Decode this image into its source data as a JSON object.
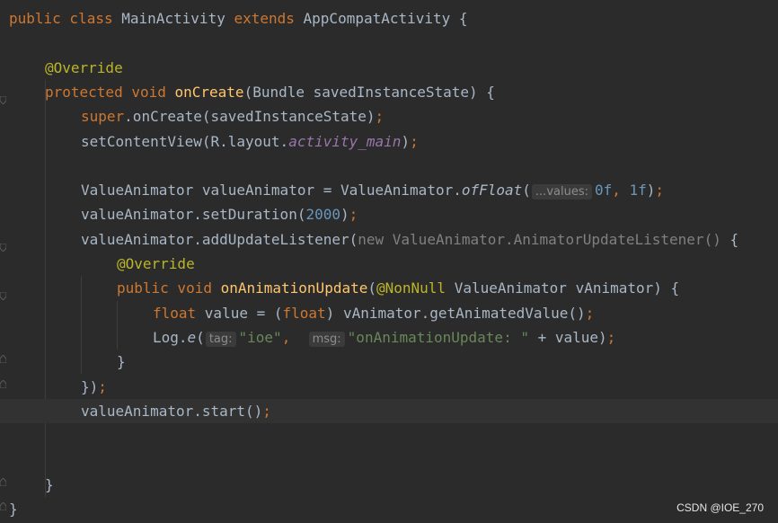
{
  "colors": {
    "keyword": "#cc7832",
    "default": "#a9b7c6",
    "annotation": "#bbb529",
    "method_decl": "#ffc66d",
    "number": "#6897bb",
    "string": "#6a8759",
    "field": "#9876aa",
    "dim": "#808080",
    "background": "#2b2b2b",
    "current_line": "#323232"
  },
  "code_lines": [
    {
      "id": "l1",
      "indent": 0,
      "tokens": [
        {
          "t": "public class ",
          "c": "keyword"
        },
        {
          "t": "MainActivity ",
          "c": "default"
        },
        {
          "t": "extends ",
          "c": "keyword"
        },
        {
          "t": "AppCompatActivity {",
          "c": "default"
        }
      ]
    },
    {
      "id": "l2",
      "indent": 0,
      "tokens": []
    },
    {
      "id": "l3",
      "indent": 1,
      "tokens": [
        {
          "t": "@Override",
          "c": "annotation"
        }
      ]
    },
    {
      "id": "l4",
      "indent": 1,
      "tokens": [
        {
          "t": "protected void ",
          "c": "keyword"
        },
        {
          "t": "onCreate",
          "c": "method_decl"
        },
        {
          "t": "(Bundle savedInstanceState) {",
          "c": "default"
        }
      ]
    },
    {
      "id": "l5",
      "indent": 2,
      "tokens": [
        {
          "t": "super",
          "c": "keyword"
        },
        {
          "t": ".onCreate(savedInstanceState)",
          "c": "default"
        },
        {
          "t": ";",
          "c": "keyword"
        }
      ]
    },
    {
      "id": "l6",
      "indent": 2,
      "tokens": [
        {
          "t": "setContentView(R.layout.",
          "c": "default"
        },
        {
          "t": "activity_main",
          "c": "field",
          "italic": true
        },
        {
          "t": ")",
          "c": "default"
        },
        {
          "t": ";",
          "c": "keyword"
        }
      ]
    },
    {
      "id": "l7",
      "indent": 0,
      "tokens": []
    },
    {
      "id": "l8",
      "indent": 2,
      "tokens": [
        {
          "t": "ValueAnimator valueAnimator = ValueAnimator.",
          "c": "default"
        },
        {
          "t": "ofFloat",
          "c": "default",
          "italic": true
        },
        {
          "t": "(",
          "c": "default"
        },
        {
          "t": "...values:",
          "hint": true
        },
        {
          "t": "0f",
          "c": "number"
        },
        {
          "t": ", ",
          "c": "keyword"
        },
        {
          "t": "1f",
          "c": "number"
        },
        {
          "t": ")",
          "c": "default"
        },
        {
          "t": ";",
          "c": "keyword"
        }
      ]
    },
    {
      "id": "l9",
      "indent": 2,
      "tokens": [
        {
          "t": "valueAnimator.setDuration(",
          "c": "default"
        },
        {
          "t": "2000",
          "c": "number"
        },
        {
          "t": ")",
          "c": "default"
        },
        {
          "t": ";",
          "c": "keyword"
        }
      ]
    },
    {
      "id": "l10",
      "indent": 2,
      "tokens": [
        {
          "t": "valueAnimator.addUpdateListener(",
          "c": "default"
        },
        {
          "t": "new ValueAnimator.AnimatorUpdateListener() ",
          "c": "dim"
        },
        {
          "t": "{",
          "c": "default"
        }
      ]
    },
    {
      "id": "l11",
      "indent": 3,
      "tokens": [
        {
          "t": "@Override",
          "c": "annotation"
        }
      ]
    },
    {
      "id": "l12",
      "indent": 3,
      "tokens": [
        {
          "t": "public void ",
          "c": "keyword"
        },
        {
          "t": "onAnimationUpdate",
          "c": "method_decl"
        },
        {
          "t": "(",
          "c": "default"
        },
        {
          "t": "@NonNull ",
          "c": "annotation"
        },
        {
          "t": "ValueAnimator vAnimator) {",
          "c": "default"
        }
      ]
    },
    {
      "id": "l13",
      "indent": 4,
      "tokens": [
        {
          "t": "float ",
          "c": "keyword"
        },
        {
          "t": "value = (",
          "c": "default"
        },
        {
          "t": "float",
          "c": "keyword"
        },
        {
          "t": ") vAnimator.getAnimatedValue()",
          "c": "default"
        },
        {
          "t": ";",
          "c": "keyword"
        }
      ]
    },
    {
      "id": "l14",
      "indent": 4,
      "tokens": [
        {
          "t": "Log.",
          "c": "default"
        },
        {
          "t": "e",
          "c": "default",
          "italic": true
        },
        {
          "t": "(",
          "c": "default"
        },
        {
          "t": "tag:",
          "hint": true
        },
        {
          "t": "\"ioe\"",
          "c": "string"
        },
        {
          "t": ",  ",
          "c": "keyword"
        },
        {
          "t": "msg:",
          "hint": true
        },
        {
          "t": "\"onAnimationUpdate: \"",
          "c": "string"
        },
        {
          "t": " + value)",
          "c": "default"
        },
        {
          "t": ";",
          "c": "keyword"
        }
      ]
    },
    {
      "id": "l15",
      "indent": 3,
      "tokens": [
        {
          "t": "}",
          "c": "default"
        }
      ]
    },
    {
      "id": "l16",
      "indent": 2,
      "tokens": [
        {
          "t": "})",
          "c": "default"
        },
        {
          "t": ";",
          "c": "keyword"
        }
      ]
    },
    {
      "id": "l17",
      "indent": 2,
      "current": true,
      "tokens": [
        {
          "t": "valueAnimator.start()",
          "c": "default"
        },
        {
          "t": ";",
          "c": "keyword"
        }
      ]
    },
    {
      "id": "l18",
      "indent": 0,
      "tokens": []
    },
    {
      "id": "l19",
      "indent": 0,
      "tokens": []
    },
    {
      "id": "l20",
      "indent": 1,
      "tokens": [
        {
          "t": "}",
          "c": "default"
        }
      ]
    },
    {
      "id": "l21",
      "indent": 0,
      "tokens": [
        {
          "t": "}",
          "c": "default"
        }
      ]
    }
  ],
  "watermark": "CSDN @IOE_270"
}
